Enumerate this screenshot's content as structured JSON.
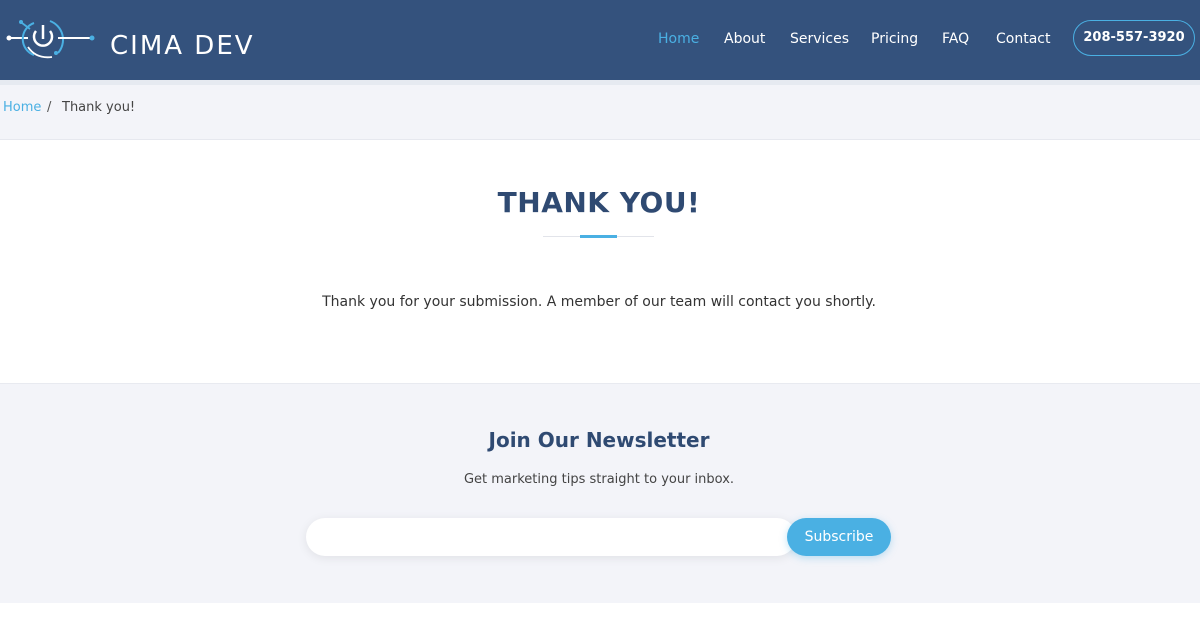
{
  "brand": {
    "name": "CIMA DEV",
    "accent": "#4ab0e3",
    "header_bg": "#34527d",
    "heading_color": "#2f4a72"
  },
  "nav": {
    "items": [
      {
        "label": "Home",
        "active": true
      },
      {
        "label": "About"
      },
      {
        "label": "Services"
      },
      {
        "label": "Pricing"
      },
      {
        "label": "FAQ"
      },
      {
        "label": "Contact"
      }
    ],
    "phone": "208-557-3920"
  },
  "breadcrumb": {
    "home": "Home",
    "separator": "/",
    "current": "Thank you!"
  },
  "main": {
    "title": "THANK YOU!",
    "message": "Thank you for your submission. A member of our team will contact you shortly."
  },
  "newsletter": {
    "title": "Join Our Newsletter",
    "subtitle": "Get marketing tips straight to your inbox.",
    "email_placeholder": "",
    "button_label": "Subscribe"
  },
  "icons": {
    "logo": "power-circuit-logo-icon"
  }
}
